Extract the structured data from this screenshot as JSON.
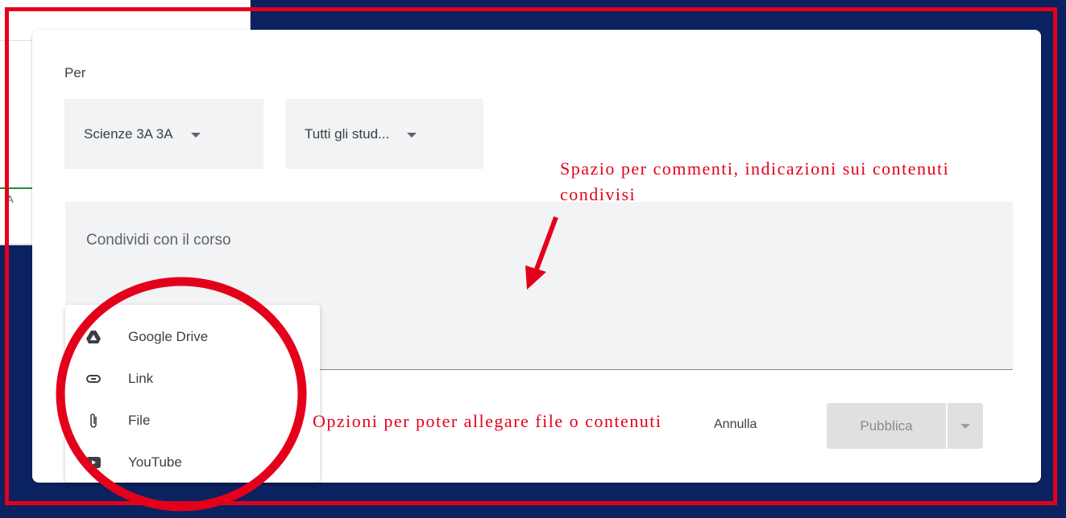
{
  "background_page": {
    "stub_text": "A"
  },
  "dialog": {
    "for_label": "Per",
    "class_selector": {
      "value": "Scienze 3A 3A"
    },
    "students_selector": {
      "value": "Tutti gli stud..."
    },
    "post_input": {
      "placeholder": "Condividi con il corso"
    },
    "attach_menu": {
      "items": [
        {
          "label": "Google Drive",
          "icon": "google-drive-icon"
        },
        {
          "label": "Link",
          "icon": "link-icon"
        },
        {
          "label": "File",
          "icon": "paperclip-icon"
        },
        {
          "label": "YouTube",
          "icon": "youtube-icon"
        }
      ]
    },
    "cancel_label": "Annulla",
    "publish_label": "Pubblica"
  },
  "annotations": {
    "comment_area_note": "Spazio per commenti, indicazioni sui contenuti condivisi",
    "attach_options_note": "Opzioni per poter allegare file o contenuti",
    "color": "#e4001b"
  }
}
